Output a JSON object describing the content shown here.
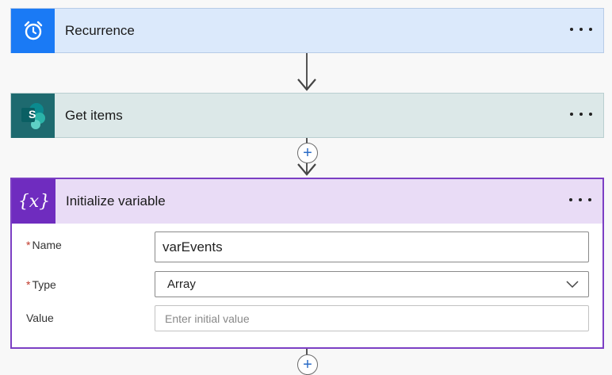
{
  "steps": {
    "recurrence": {
      "title": "Recurrence",
      "icon": "alarm-clock-icon",
      "color": "#1a7af5"
    },
    "get_items": {
      "title": "Get items",
      "icon": "sharepoint-icon",
      "icon_letter": "S",
      "color": "#1e6a6f"
    },
    "init_variable": {
      "title": "Initialize variable",
      "icon": "variable-icon",
      "color": "#6f2cbf",
      "fields": {
        "name": {
          "label": "Name",
          "required_mark": "*",
          "value": "varEvents"
        },
        "type": {
          "label": "Type",
          "required_mark": "*",
          "value": "Array"
        },
        "value": {
          "label": "Value",
          "placeholder": "Enter initial value"
        }
      }
    }
  },
  "connectors": {
    "plus_label": "+"
  }
}
